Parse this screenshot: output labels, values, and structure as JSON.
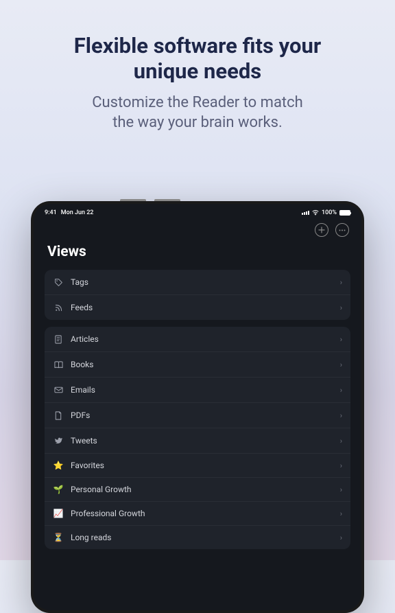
{
  "hero": {
    "title_line1": "Flexible software fits your",
    "title_line2": "unique needs",
    "subtitle_line1": "Customize the Reader to match",
    "subtitle_line2": "the way your brain works."
  },
  "status": {
    "time": "9:41",
    "date": "Mon Jun 22",
    "battery": "100%"
  },
  "screen": {
    "title": "Views"
  },
  "group1": [
    {
      "icon": "tag",
      "label": "Tags"
    },
    {
      "icon": "rss",
      "label": "Feeds"
    }
  ],
  "group2": [
    {
      "icon": "doc",
      "label": "Articles"
    },
    {
      "icon": "book",
      "label": "Books"
    },
    {
      "icon": "mail",
      "label": "Emails"
    },
    {
      "icon": "pdf",
      "label": "PDFs"
    },
    {
      "icon": "bird",
      "label": "Tweets"
    },
    {
      "emoji": "⭐",
      "label": "Favorites"
    },
    {
      "emoji": "🌱",
      "label": "Personal Growth"
    },
    {
      "emoji": "📈",
      "label": "Professional Growth"
    },
    {
      "emoji": "⏳",
      "label": "Long reads"
    }
  ]
}
